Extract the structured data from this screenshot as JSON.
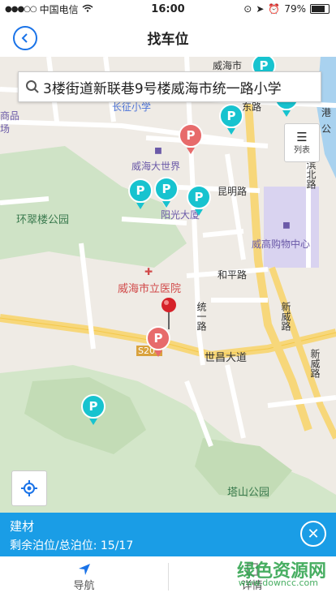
{
  "status_bar": {
    "carrier": "中国电信",
    "time": "16:00",
    "battery": "79%"
  },
  "nav": {
    "title": "找车位",
    "back_icon": "chevron-left-icon"
  },
  "search": {
    "value": "3楼街道新联巷9号楼威海市统一路小学"
  },
  "list_button": {
    "label": "列表"
  },
  "map_labels": {
    "weihai_shi": "威海市",
    "changzheng_xiaoxue": "长征小学",
    "dongfang_lu": "东路",
    "shangpin": "商品",
    "chang": "场",
    "weihai_dashijie": "威海大世界",
    "yangguang_dasha": "阳光大厦",
    "kunming_lu": "昆明路",
    "huancuilou_gongyuan": "环翠楼公园",
    "weigao_gouwu": "威高购物中心",
    "hai_binbei_lu": "海滨北路",
    "heping_lu": "和平路",
    "weihai_yiyuan": "威海市立医院",
    "tongyi_lu": "统一路",
    "xin_wei_lu": "新威路",
    "shichang_dadao": "世昌大道",
    "xin_wei_lu2": "新威路",
    "s203": "S203",
    "tashan_gongyuan": "塔山公园",
    "gang": "港",
    "gong": "公"
  },
  "selected_lot": {
    "name": "建材",
    "availability": "剩余泊位/总泊位: 15/17"
  },
  "tabs": [
    {
      "label": "导航"
    },
    {
      "label": "详情"
    }
  ],
  "watermark": {
    "text": "绿色资源网",
    "url": "www.downcc.com"
  },
  "colors": {
    "accent": "#1a9de6",
    "pin_cyan": "#17c3cf",
    "pin_red": "#e76b6b",
    "marker_red": "#d6222a"
  }
}
